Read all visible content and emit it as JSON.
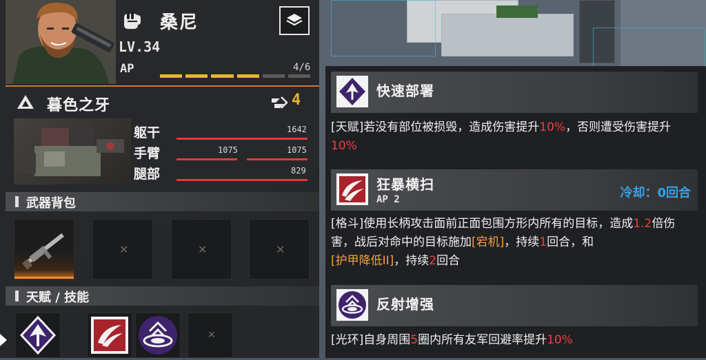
{
  "unit": {
    "name": "桑尼",
    "level": "LV.34",
    "ap_label": "AP",
    "ap_current": 4,
    "ap_max": 6,
    "ap_text": "4/6"
  },
  "mech": {
    "name": "暮色之牙",
    "speed": "4",
    "parts": [
      {
        "name": "躯干",
        "values": [
          "1642"
        ]
      },
      {
        "name": "手臂",
        "values": [
          "1075",
          "1075"
        ]
      },
      {
        "name": "腿部",
        "values": [
          "829"
        ]
      }
    ]
  },
  "sections": {
    "weapons": "武器背包",
    "skills": "天赋 / 技能"
  },
  "skills": [
    {
      "title": "快速部署",
      "desc": [
        "[天赋]若没有部位被损毁，造成伤害提升",
        "10%",
        "，否则遭受伤害提升",
        "10%"
      ]
    },
    {
      "title": "狂暴横扫",
      "ap": "AP 2",
      "cooldown": "冷却：0回合",
      "desc": [
        "[格斗]使用长柄攻击面前正面包围方形内所有的目标，造成",
        "1.2",
        "倍伤害，战后对命中的目标施加",
        "[宕机]",
        "，持续",
        "1",
        "回合，和",
        "[护甲降低II]",
        "，持续",
        "2",
        "回合"
      ]
    },
    {
      "title": "反射增强",
      "desc": [
        "[光环]自身周围",
        "5",
        "圈内所有友军回避率提升",
        "10%"
      ]
    }
  ],
  "colors": {
    "accent_yellow": "#e8b536",
    "hp_red": "#e23b3b",
    "highlight_red": "#ef4040",
    "status_orange": "#f1a23b",
    "cooldown_blue": "#39a3e6",
    "skill_purple": "#4a2c7a",
    "skill_crimson": "#a8232b"
  },
  "icons": {
    "unit": "fist-icon",
    "layer": "layers-icon",
    "mech_class": "triangle-class-icon",
    "speed": "speed-icon",
    "weapon": "rifle-icon",
    "skill1": "deploy-emblem-icon",
    "skill2": "slash-sweep-icon",
    "skill3": "reflect-aura-icon"
  }
}
